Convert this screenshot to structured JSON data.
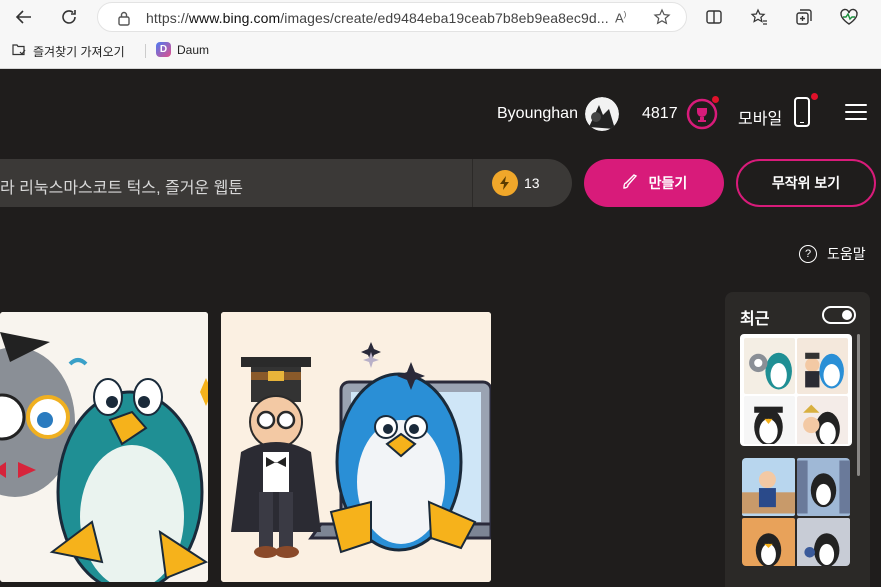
{
  "browser": {
    "url_prefix": "https://",
    "url_domain": "www.bing.com",
    "url_path": "/images/create/ed9484eba19ceab7b8eb9ea8ec9d...",
    "bookmarks": [
      "즐겨찾기 가져오기",
      "Daum"
    ]
  },
  "header": {
    "user_name": "Byounghan",
    "points": "4817",
    "mobile_label": "모바일"
  },
  "search": {
    "prompt_text": "라 리눅스마스코트 턱스, 즐거운 웹툰",
    "boosts": "13",
    "create_label": "만들기",
    "surprise_label": "무작위 보기"
  },
  "help_label": "도움말",
  "recent": {
    "label": "최근"
  },
  "colors": {
    "accent": "#d81b7a",
    "background": "#1f1d1c",
    "boost": "#f0a72a"
  }
}
